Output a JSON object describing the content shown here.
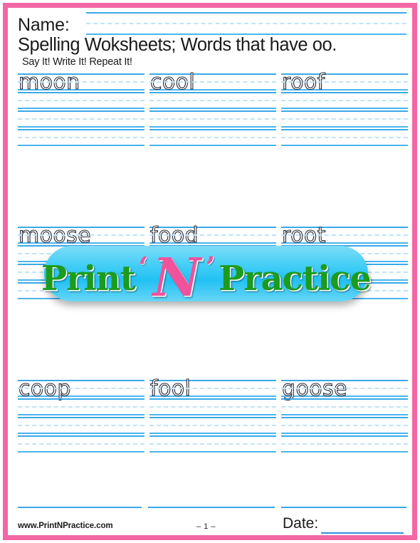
{
  "meta": {
    "border_color": "#f368a4",
    "rule_solid_color": "#3aa9e8",
    "rule_dashed_color": "#bfe4f8"
  },
  "header": {
    "name_label": "Name:",
    "title": "Spelling Woksheets; Words that have oo.",
    "subtitle": "Say It! Write It! Repeat It!"
  },
  "body": {
    "rows": [
      {
        "words": [
          "moon",
          "cool",
          "roof"
        ]
      },
      {
        "words": [
          "moose",
          "food",
          "root"
        ]
      },
      {
        "words": [
          "coop",
          "fool",
          "goose"
        ]
      }
    ],
    "practice_lines_per_word": 4
  },
  "watermark": {
    "word1": "Print",
    "letter": "N",
    "quote_open": "‘",
    "quote_close": "’",
    "word2": "Practice",
    "pill_color": "#3fcdf6",
    "text_color": "#1d9b1d",
    "letter_color": "#f0529c"
  },
  "footer": {
    "website": "www.PrintNPractice.com",
    "page_number": "– 1 –",
    "date_label": "Date:"
  }
}
